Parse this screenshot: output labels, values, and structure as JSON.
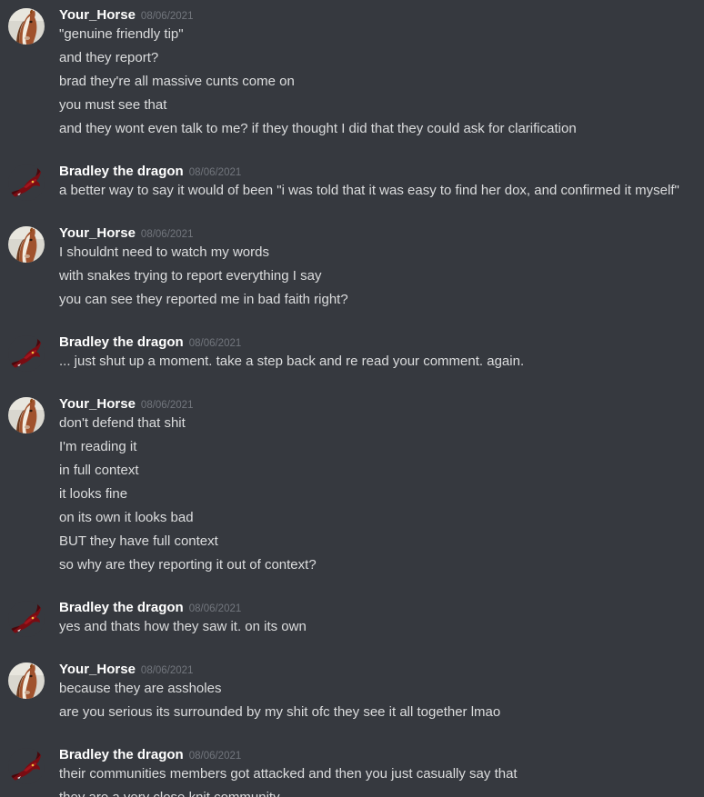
{
  "colors": {
    "background": "#36393f",
    "username": "#ffffff",
    "timestamp": "#72767d",
    "message_text": "#dcddde"
  },
  "messages": [
    {
      "author": "Your_Horse",
      "avatar_icon": "horse-avatar-icon",
      "timestamp": "08/06/2021",
      "lines": [
        "\"genuine friendly tip\"",
        "and they report?",
        "brad they're all massive cunts come on",
        "you must see that",
        "and they wont even talk to me? if they thought I did that they could ask for clarification"
      ]
    },
    {
      "author": "Bradley the dragon",
      "avatar_icon": "dragon-avatar-icon",
      "timestamp": "08/06/2021",
      "lines": [
        "a better way to say it would of been \"i was told that it was easy to find her dox, and confirmed it myself\""
      ]
    },
    {
      "author": "Your_Horse",
      "avatar_icon": "horse-avatar-icon",
      "timestamp": "08/06/2021",
      "lines": [
        "I shouldnt need to watch my words",
        "with snakes trying to report everything I say",
        "you can see they reported me in bad faith right?"
      ]
    },
    {
      "author": "Bradley the dragon",
      "avatar_icon": "dragon-avatar-icon",
      "timestamp": "08/06/2021",
      "lines": [
        "... just shut up a moment. take a step back and re read your comment. again."
      ]
    },
    {
      "author": "Your_Horse",
      "avatar_icon": "horse-avatar-icon",
      "timestamp": "08/06/2021",
      "lines": [
        "don't defend that shit",
        "I'm reading it",
        "in full context",
        "it looks fine",
        "on its own it looks bad",
        "BUT they have full context",
        "so why are they reporting it out of context?"
      ]
    },
    {
      "author": "Bradley the dragon",
      "avatar_icon": "dragon-avatar-icon",
      "timestamp": "08/06/2021",
      "lines": [
        "yes and thats how they saw it. on its own"
      ]
    },
    {
      "author": "Your_Horse",
      "avatar_icon": "horse-avatar-icon",
      "timestamp": "08/06/2021",
      "lines": [
        "because they are assholes",
        "are you serious its surrounded by my shit ofc they see it all together lmao"
      ]
    },
    {
      "author": "Bradley the dragon",
      "avatar_icon": "dragon-avatar-icon",
      "timestamp": "08/06/2021",
      "lines": [
        "their communities members got attacked and then you just casually say that",
        "they are a very close knit community"
      ]
    }
  ]
}
